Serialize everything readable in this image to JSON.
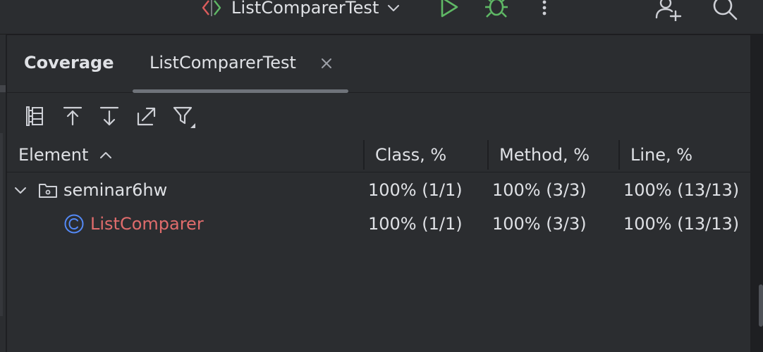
{
  "toolbar": {
    "config_name": "ListComparerTest",
    "run_icon": "run-icon",
    "debug_icon": "debug-icon",
    "more_icon": "more-vertical-icon",
    "add_user_icon": "add-user-icon",
    "search_icon": "search-icon"
  },
  "tabs": {
    "coverage": "Coverage",
    "active": "ListComparerTest"
  },
  "actions": [
    "flatten-packages-icon",
    "import-icon",
    "export-icon",
    "open-external-icon",
    "filter-icon"
  ],
  "table": {
    "columns": {
      "element": "Element",
      "class": "Class, %",
      "method": "Method, %",
      "line": "Line, %"
    },
    "rows": [
      {
        "name": "seminar6hw",
        "icon": "package-folder-icon",
        "class": "100% (1/1)",
        "method": "100% (3/3)",
        "line": "100% (13/13)"
      },
      {
        "name": "ListComparer",
        "icon": "class-icon",
        "class": "100% (1/1)",
        "method": "100% (3/3)",
        "line": "100% (13/13)"
      }
    ]
  },
  "colors": {
    "run": "#5fb865",
    "class_icon": "#548af7",
    "class_name": "#e06c6c",
    "panel_bg": "#2b2d30"
  }
}
